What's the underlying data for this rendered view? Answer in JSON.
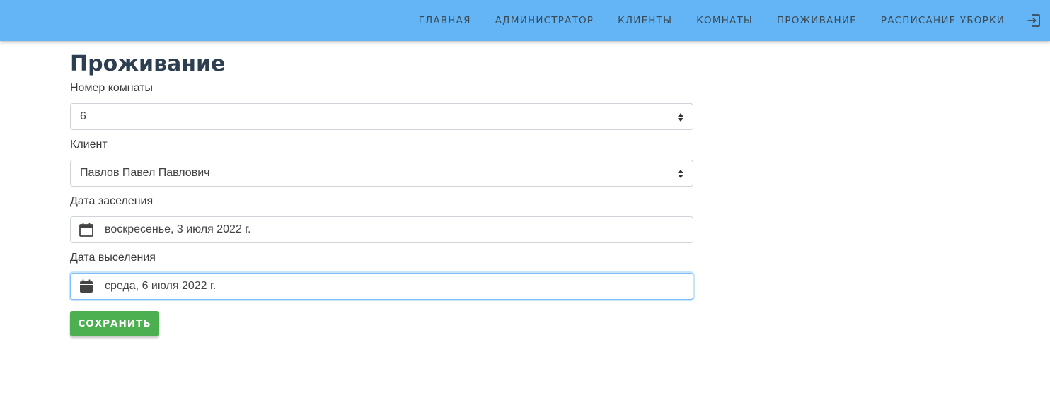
{
  "nav": {
    "items": [
      {
        "label": "ГЛАВНАЯ"
      },
      {
        "label": "АДМИНИСТРАТОР"
      },
      {
        "label": "КЛИЕНТЫ"
      },
      {
        "label": "КОМНАТЫ"
      },
      {
        "label": "ПРОЖИВАНИЕ"
      },
      {
        "label": "РАСПИСАНИЕ УБОРКИ"
      }
    ],
    "logout_icon": "logout-icon",
    "background_color": "#64b5f6"
  },
  "page": {
    "title": "Проживание"
  },
  "form": {
    "room": {
      "label": "Номер комнаты",
      "value": "6"
    },
    "client": {
      "label": "Клиент",
      "value": "Павлов Павел Павлович"
    },
    "checkin": {
      "label": "Дата заселения",
      "value": "воскресенье, 3 июля 2022 г.",
      "icon": "calendar-outline-icon"
    },
    "checkout": {
      "label": "Дата выселения",
      "value": "среда, 6 июля 2022 г.",
      "icon": "calendar-filled-icon"
    },
    "save_label": "СОХРАНИТЬ",
    "save_color": "#4caf50"
  }
}
